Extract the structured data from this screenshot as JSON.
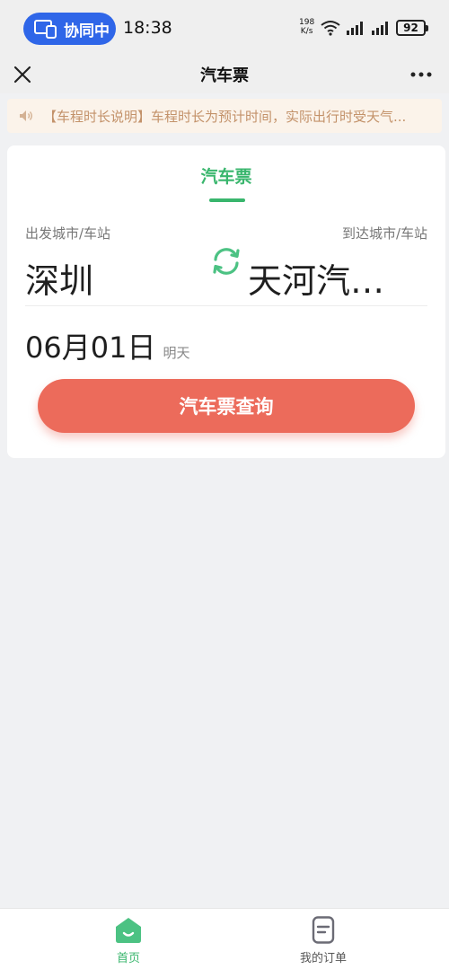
{
  "status_bar": {
    "collab_label": "协同中",
    "time": "18:38",
    "net_speed_value": "198",
    "net_speed_unit": "K/s",
    "battery": "92"
  },
  "nav": {
    "title": "汽车票"
  },
  "notice": {
    "text": "【车程时长说明】车程时长为预计时间，实际出行时受天气..."
  },
  "card": {
    "tab_title": "汽车票",
    "from_label": "出发城市/车站",
    "to_label": "到达城市/车站",
    "from_city": "深圳",
    "to_city": "天河汽…",
    "date": "06月01日",
    "date_hint": "明天",
    "search_button": "汽车票查询"
  },
  "tabbar": {
    "home_label": "首页",
    "orders_label": "我的订单"
  },
  "colors": {
    "accent_green": "#39b66d",
    "button_red": "#ec6b5b",
    "notice_text": "#c3926a",
    "collab_blue": "#2f66e8"
  }
}
